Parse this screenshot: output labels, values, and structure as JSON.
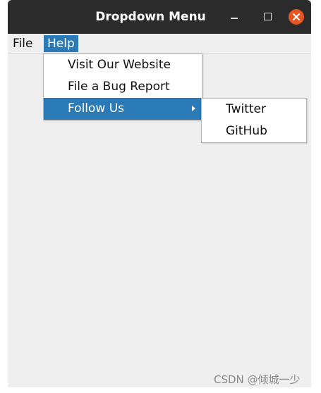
{
  "window": {
    "title": "Dropdown Menu",
    "controls": {
      "minimize_icon": "minimize-icon",
      "maximize_icon": "maximize-icon",
      "close_icon": "close-icon",
      "close_color": "#e95420"
    }
  },
  "menubar": {
    "items": [
      {
        "label": "File"
      },
      {
        "label": "Help"
      }
    ]
  },
  "help_menu": {
    "items": [
      {
        "label": "Visit Our Website"
      },
      {
        "label": "File a Bug Report"
      },
      {
        "label": "Follow Us",
        "has_submenu": true,
        "selected": true
      }
    ]
  },
  "follow_submenu": {
    "items": [
      {
        "label": "Twitter"
      },
      {
        "label": "GitHub"
      }
    ]
  },
  "watermark": "CSDN @倾城一少",
  "colors": {
    "titlebar": "#2b2b2b",
    "selection": "#2a7ab8",
    "window_bg": "#efefef"
  }
}
